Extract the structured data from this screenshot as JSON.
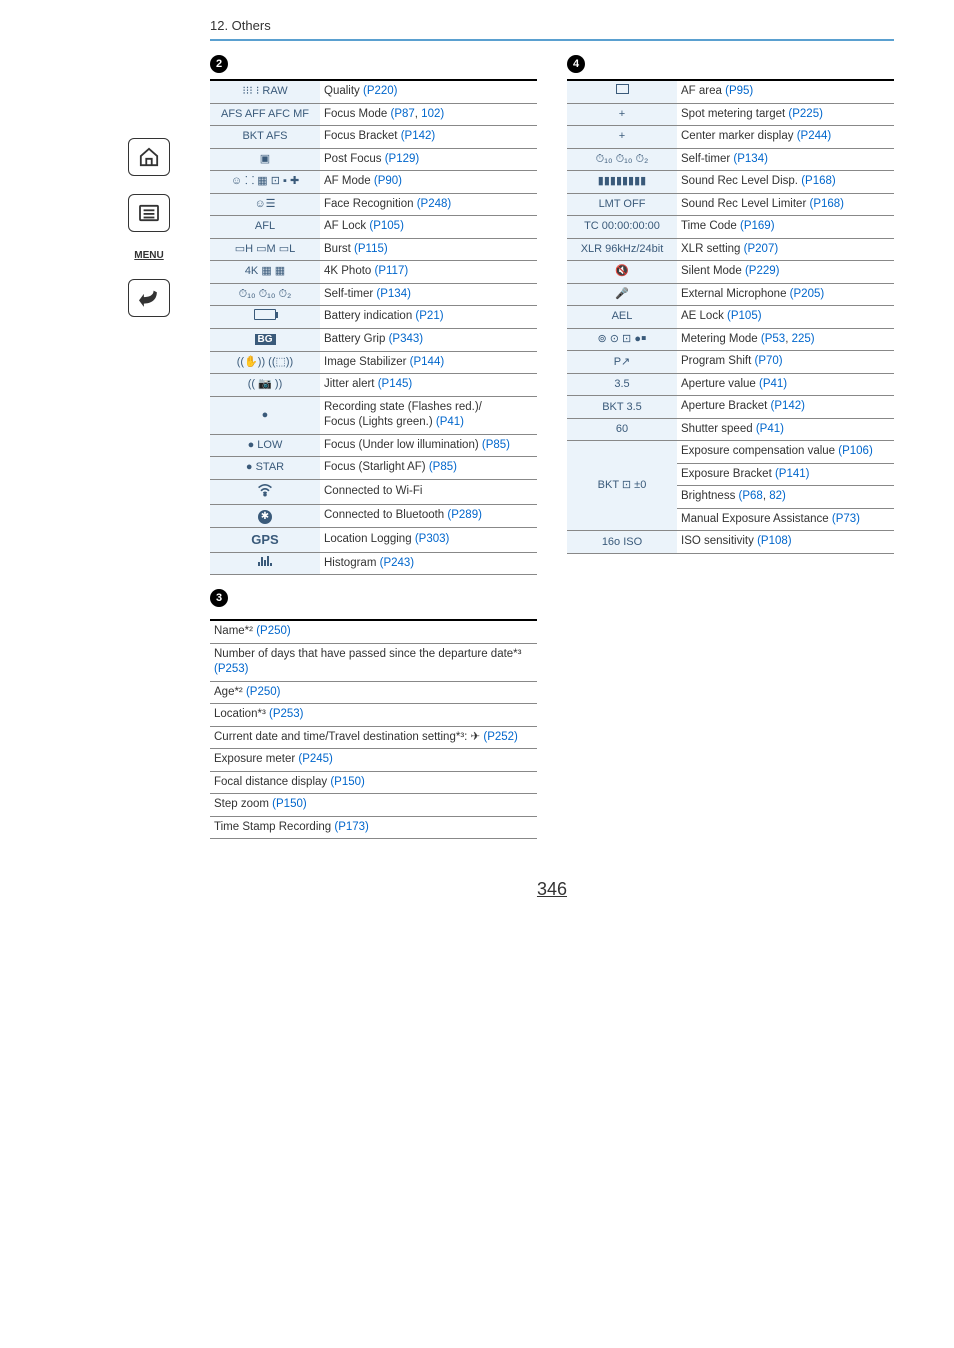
{
  "chapter": "12. Others",
  "page_number": "346",
  "sidebar": {
    "menu": "MENU"
  },
  "section_numbers": {
    "s2": "2",
    "s3": "3",
    "s4": "4"
  },
  "table2": [
    {
      "icon": "⁝⁝⁝ ⁝ RAW",
      "desc": "Quality ",
      "links": [
        {
          "t": "(P220)"
        }
      ]
    },
    {
      "icon": "AFS AFF AFC MF",
      "desc": "Focus Mode ",
      "links": [
        {
          "t": "(P87"
        },
        {
          "t": ", "
        },
        {
          "t": "102)"
        }
      ]
    },
    {
      "icon": "BKT AFS",
      "desc": "Focus Bracket ",
      "links": [
        {
          "t": "(P142)"
        }
      ]
    },
    {
      "icon": "▣",
      "desc": "Post Focus ",
      "links": [
        {
          "t": "(P129)"
        }
      ]
    },
    {
      "icon": "☺ ⸬ ▦ ⊡ ▪ ✚",
      "desc": "AF Mode ",
      "links": [
        {
          "t": "(P90)"
        }
      ]
    },
    {
      "icon": "☺☰",
      "desc": "Face Recognition ",
      "links": [
        {
          "t": "(P248)"
        }
      ]
    },
    {
      "icon": "AFL",
      "desc": "AF Lock ",
      "links": [
        {
          "t": "(P105)"
        }
      ]
    },
    {
      "icon": "▭H ▭M ▭L",
      "desc": "Burst ",
      "links": [
        {
          "t": "(P115)"
        }
      ]
    },
    {
      "icon": "4K ▦ ▦",
      "desc": "4K Photo ",
      "links": [
        {
          "t": "(P117)"
        }
      ]
    },
    {
      "icon": "⏱₁₀ ⏱₁₀ ⏱₂",
      "desc": "Self-timer ",
      "links": [
        {
          "t": "(P134)"
        }
      ]
    },
    {
      "icon": "battery",
      "desc": "Battery indication ",
      "links": [
        {
          "t": "(P21)"
        }
      ]
    },
    {
      "icon": "BG",
      "desc": "Battery Grip ",
      "links": [
        {
          "t": "(P343)"
        }
      ]
    },
    {
      "icon": "((✋)) ((⬚))",
      "desc": "Image Stabilizer ",
      "links": [
        {
          "t": "(P144)"
        }
      ]
    },
    {
      "icon": "(( 📷 ))",
      "desc": "Jitter alert ",
      "links": [
        {
          "t": "(P145)"
        }
      ]
    },
    {
      "icon": "●",
      "desc": "Recording state (Flashes red.)/\nFocus (Lights green.) ",
      "links": [
        {
          "t": "(P41)"
        }
      ]
    },
    {
      "icon": "● LOW",
      "desc": "Focus (Under low illumination) ",
      "links": [
        {
          "t": "(P85)"
        }
      ]
    },
    {
      "icon": "● STAR",
      "desc": "Focus (Starlight AF) ",
      "links": [
        {
          "t": "(P85)"
        }
      ]
    },
    {
      "icon": "wifi",
      "desc": "Connected to Wi-Fi",
      "links": []
    },
    {
      "icon": "bt",
      "desc": "Connected to Bluetooth ",
      "links": [
        {
          "t": "(P289)"
        }
      ]
    },
    {
      "icon": "GPS",
      "desc": "Location Logging ",
      "links": [
        {
          "t": "(P303)"
        }
      ]
    },
    {
      "icon": "histogram",
      "desc": "Histogram ",
      "links": [
        {
          "t": "(P243)"
        }
      ]
    }
  ],
  "table3": [
    {
      "desc": "Name*² ",
      "links": [
        {
          "t": "(P250)"
        }
      ]
    },
    {
      "desc": "Number of days that have passed since the departure date*³ ",
      "links": [
        {
          "t": "(P253)"
        }
      ]
    },
    {
      "desc": "Age*² ",
      "links": [
        {
          "t": "(P250)"
        }
      ]
    },
    {
      "desc": "Location*³ ",
      "links": [
        {
          "t": "(P253)"
        }
      ]
    },
    {
      "desc": "Current date and time/Travel destination setting*³: ✈ ",
      "links": [
        {
          "t": "(P252)"
        }
      ]
    },
    {
      "desc": "Exposure meter ",
      "links": [
        {
          "t": "(P245)"
        }
      ]
    },
    {
      "desc": "Focal distance display ",
      "links": [
        {
          "t": "(P150)"
        }
      ]
    },
    {
      "desc": "Step zoom ",
      "links": [
        {
          "t": "(P150)"
        }
      ]
    },
    {
      "desc": "Time Stamp Recording ",
      "links": [
        {
          "t": "(P173)"
        }
      ]
    }
  ],
  "table4": [
    {
      "icon": "▭",
      "desc": "AF area ",
      "links": [
        {
          "t": "(P95)"
        }
      ]
    },
    {
      "icon": "+",
      "desc": "Spot metering target ",
      "links": [
        {
          "t": "(P225)"
        }
      ]
    },
    {
      "icon": "+",
      "desc": "Center marker display ",
      "links": [
        {
          "t": "(P244)"
        }
      ]
    },
    {
      "icon": "⏱₁₀ ⏱₁₀ ⏱₂",
      "desc": "Self-timer ",
      "links": [
        {
          "t": "(P134)"
        }
      ]
    },
    {
      "icon": "▮▮▮▮▮▮▮▮",
      "desc": "Sound Rec Level Disp. ",
      "links": [
        {
          "t": "(P168)"
        }
      ]
    },
    {
      "icon": "LMT OFF",
      "desc": "Sound Rec Level Limiter ",
      "links": [
        {
          "t": "(P168)"
        }
      ]
    },
    {
      "icon": "TC 00:00:00:00",
      "desc": "Time Code ",
      "links": [
        {
          "t": "(P169)"
        }
      ]
    },
    {
      "icon": "XLR 96kHz/24bit",
      "desc": "XLR setting ",
      "links": [
        {
          "t": "(P207)"
        }
      ]
    },
    {
      "icon": "🔇",
      "desc": "Silent Mode ",
      "links": [
        {
          "t": "(P229)"
        }
      ]
    },
    {
      "icon": "🎤",
      "desc": "External Microphone ",
      "links": [
        {
          "t": "(P205)"
        }
      ]
    },
    {
      "icon": "AEL",
      "desc": "AE Lock ",
      "links": [
        {
          "t": "(P105)"
        }
      ]
    },
    {
      "icon": "⊚ ⊙ ⊡ ●￭",
      "desc": "Metering Mode ",
      "links": [
        {
          "t": "(P53"
        },
        {
          "t": ", "
        },
        {
          "t": "225)"
        }
      ]
    },
    {
      "icon": "P↗",
      "desc": "Program Shift ",
      "links": [
        {
          "t": "(P70)"
        }
      ]
    },
    {
      "icon": "3.5",
      "desc": "Aperture value ",
      "links": [
        {
          "t": "(P41)"
        }
      ]
    },
    {
      "icon": "BKT 3.5",
      "desc": "Aperture Bracket ",
      "links": [
        {
          "t": "(P142)"
        }
      ]
    },
    {
      "icon": "60",
      "desc": "Shutter speed ",
      "links": [
        {
          "t": "(P41)"
        }
      ]
    }
  ],
  "table4_merged": {
    "icon": "BKT ⊡ ±0",
    "rows": [
      {
        "desc": "Exposure compensation value ",
        "links": [
          {
            "t": "(P106)"
          }
        ]
      },
      {
        "desc": "Exposure Bracket ",
        "links": [
          {
            "t": "(P141)"
          }
        ]
      },
      {
        "desc": "Brightness ",
        "links": [
          {
            "t": "(P68"
          },
          {
            "t": ", "
          },
          {
            "t": "82)"
          }
        ]
      },
      {
        "desc": "Manual Exposure Assistance ",
        "links": [
          {
            "t": "(P73)"
          }
        ]
      }
    ]
  },
  "table4_last": {
    "icon": "16o ISO",
    "desc": "ISO sensitivity ",
    "links": [
      {
        "t": "(P108)"
      }
    ]
  }
}
